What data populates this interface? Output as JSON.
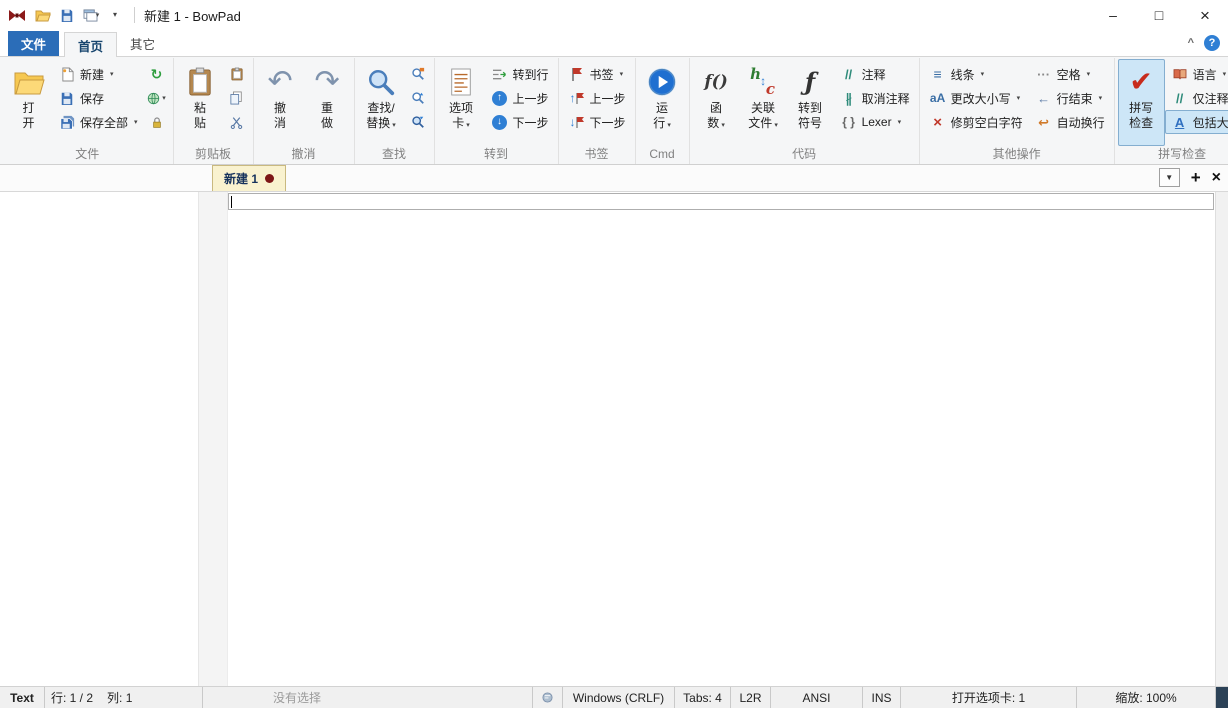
{
  "titlebar": {
    "title": "新建 1 - BowPad"
  },
  "ribbon_tabs": {
    "file": "文件",
    "home": "首页",
    "other": "其它"
  },
  "ribbon": {
    "file_group": {
      "label": "文件",
      "open_l1": "打",
      "open_l2": "开",
      "new_label": "新建",
      "save_label": "保存",
      "save_all_label": "保存全部"
    },
    "clipboard_group": {
      "label": "剪贴板",
      "paste_l1": "粘",
      "paste_l2": "贴"
    },
    "undo_group": {
      "label": "撤消",
      "undo_l1": "撤",
      "undo_l2": "消",
      "redo_l1": "重",
      "redo_l2": "做"
    },
    "find_group": {
      "label": "查找",
      "find_l1": "查找/",
      "find_l2": "替换"
    },
    "goto_group": {
      "label": "转到",
      "tabs_l1": "选项",
      "tabs_l2": "卡",
      "goto_line_label": "转到行",
      "prev_label": "上一步",
      "next_label": "下一步"
    },
    "bookmark_group": {
      "label": "书签",
      "bookmark_label": "书签",
      "prev_label": "上一步",
      "next_label": "下一步"
    },
    "cmd_group": {
      "label": "Cmd",
      "run_l1": "运",
      "run_l2": "行"
    },
    "code_group": {
      "label": "代码",
      "func_l1": "函",
      "func_l2": "数",
      "related_l1": "关联",
      "related_l2": "文件",
      "symbol_l1": "转到",
      "symbol_l2": "符号",
      "comment_label": "注释",
      "uncomment_label": "取消注释",
      "lexer_label": "Lexer"
    },
    "ops_group": {
      "label": "其他操作",
      "lines_label": "线条",
      "case_label": "更改大小写",
      "trim_label": "修剪空白字符",
      "spaces_label": "空格",
      "eol_label": "行结束",
      "wrap_label": "自动换行"
    },
    "spell_group": {
      "label": "拼写检查",
      "spell_l1": "拼写",
      "spell_l2": "检查",
      "lang_label": "语言",
      "comments_only_label": "仅注释",
      "include_caps_label": "包括大写"
    }
  },
  "tabbar": {
    "tab_label": "新建 1"
  },
  "statusbar": {
    "doctype": "Text",
    "line": "行: 1 / 2",
    "col": "列: 1",
    "selection": "没有选择",
    "eol": "Windows (CRLF)",
    "tabs": "Tabs: 4",
    "direction": "L2R",
    "encoding": "ANSI",
    "insert_mode": "INS",
    "open_tabs": "打开选项卡: 1",
    "zoom": "缩放: 100%"
  },
  "colors": {
    "accent_blue": "#2b6db8",
    "toggle_bg": "#cde6f7",
    "tab_bg": "#f9f2cf",
    "modified_dot": "#7d1616"
  },
  "icons": {
    "dropdown": {
      "glyph": "▾",
      "color": "#444"
    },
    "min": {
      "glyph": "–",
      "color": "#222"
    },
    "max": {
      "glyph": "□",
      "color": "#222"
    },
    "close": {
      "glyph": "×",
      "color": "#222"
    },
    "collapse": {
      "glyph": "^",
      "color": "#666"
    },
    "help": {
      "glyph": "?",
      "color": "#fff"
    },
    "tab_list": {
      "glyph": "▼",
      "color": "#333"
    },
    "tab_plus": {
      "glyph": "+",
      "color": "#111"
    },
    "tab_close": {
      "glyph": "×",
      "color": "#111"
    },
    "undo": {
      "glyph": "↶",
      "color": "#7f93ad"
    },
    "redo": {
      "glyph": "↷",
      "color": "#7f93ad"
    },
    "refresh": {
      "glyph": "↻",
      "color": "#2e9e3e"
    },
    "arrow_up_w": {
      "glyph": "↑",
      "color": "#ffffff"
    },
    "arrow_down_w": {
      "glyph": "↓",
      "color": "#ffffff"
    },
    "bm_up": {
      "glyph": "↑",
      "color": "#2f7fd4"
    },
    "bm_down": {
      "glyph": "↓",
      "color": "#2f7fd4"
    },
    "comment": {
      "glyph": "//",
      "color": "#2e8b7a"
    },
    "uncomment": {
      "glyph": "∦",
      "color": "#2e8b7a"
    },
    "braces": {
      "glyph": "{ }",
      "color": "#666"
    },
    "lines": {
      "glyph": "≡",
      "color": "#3a6ea5"
    },
    "case": {
      "glyph": "aA",
      "color": "#3a6ea5"
    },
    "trim": {
      "glyph": "×",
      "color": "#c0392b"
    },
    "spaces": {
      "glyph": "···",
      "color": "#888"
    },
    "eol": {
      "glyph": "←",
      "color": "#5a7aa6"
    },
    "wrap": {
      "glyph": "↩",
      "color": "#d07a2a"
    },
    "caps": {
      "glyph": "A",
      "color": "#2f6fc0"
    },
    "spell": {
      "glyph": "✔",
      "color": "#c72b1c"
    },
    "fn": {
      "glyph": "f()",
      "color": "#3a3a3a"
    },
    "hc_h": {
      "glyph": "h",
      "color": "#2e7d32"
    },
    "hc_c": {
      "glyph": "c",
      "color": "#c0392b"
    },
    "hc_arrow": {
      "glyph": "↕",
      "color": "#2f7fd4"
    },
    "fsym": {
      "glyph": "ƒ",
      "color": "#333"
    }
  }
}
